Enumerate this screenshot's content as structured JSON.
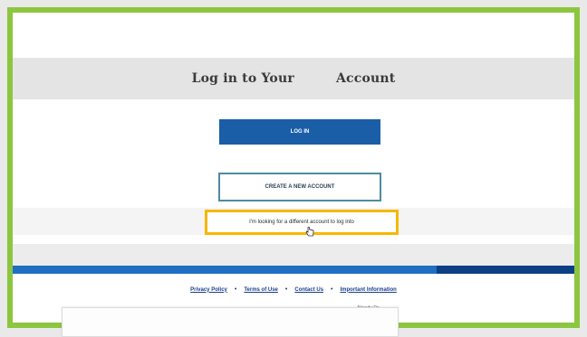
{
  "header": {
    "title_part_1": "Log in to Your",
    "title_part_2": "Account"
  },
  "actions": {
    "login_label": "LOG IN",
    "create_label": "CREATE A NEW ACCOUNT",
    "alt_account_label": "I'm looking for a different account to log into"
  },
  "footer": {
    "links": [
      "Privacy Policy",
      "Terms of Use",
      "Contact Us",
      "Important Information"
    ],
    "separator": "•",
    "note": "Already Re..."
  },
  "colors": {
    "frame_border": "#8cc63f",
    "login_button": "#1a5ea8",
    "highlight": "#f5b800",
    "footer_bar": "#1f6fc2"
  },
  "icons": {
    "cursor": "hand-cursor-icon"
  }
}
